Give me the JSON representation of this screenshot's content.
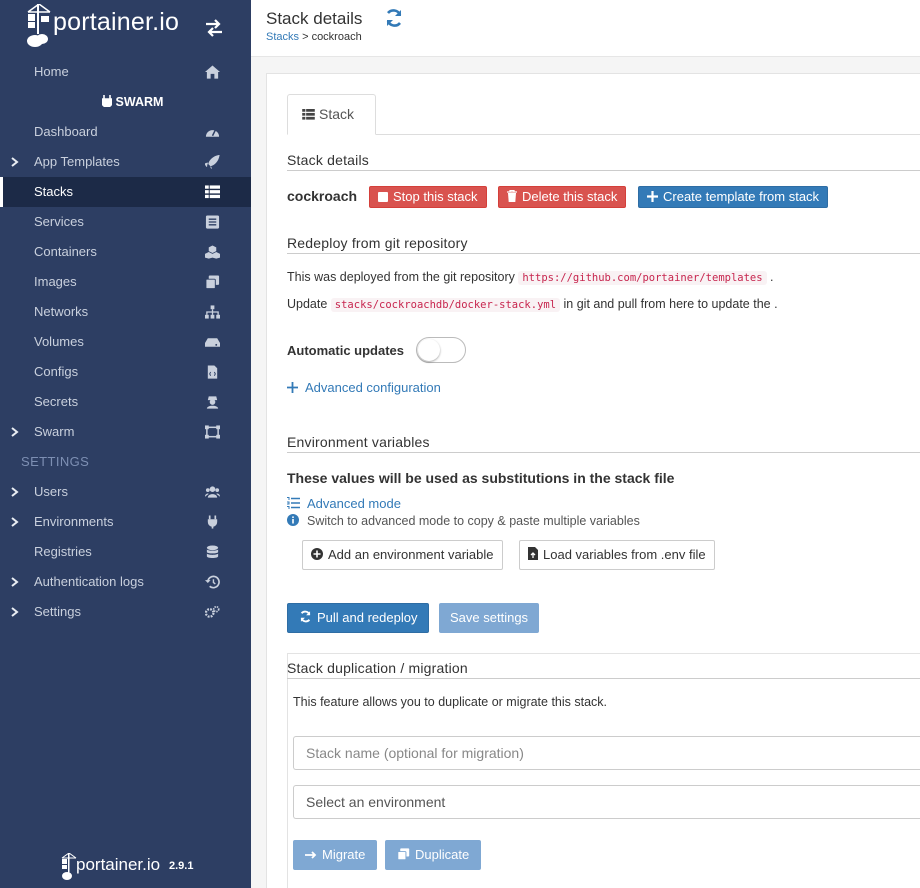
{
  "brand": {
    "name": "portainer.io"
  },
  "sidebar": {
    "home": "Home",
    "group": "SWARM",
    "items": [
      {
        "label": "Dashboard",
        "icon": "tachometer-icon"
      },
      {
        "label": "App Templates",
        "icon": "rocket-icon",
        "expandable": true
      },
      {
        "label": "Stacks",
        "icon": "th-list-icon",
        "active": true
      },
      {
        "label": "Services",
        "icon": "list-alt-icon"
      },
      {
        "label": "Containers",
        "icon": "cubes-icon"
      },
      {
        "label": "Images",
        "icon": "clone-icon"
      },
      {
        "label": "Networks",
        "icon": "sitemap-icon"
      },
      {
        "label": "Volumes",
        "icon": "hdd-icon"
      },
      {
        "label": "Configs",
        "icon": "file-code-icon"
      },
      {
        "label": "Secrets",
        "icon": "user-secret-icon"
      },
      {
        "label": "Swarm",
        "icon": "object-group-icon",
        "expandable": true
      }
    ],
    "settings_header": "SETTINGS",
    "settings_items": [
      {
        "label": "Users",
        "icon": "users-icon",
        "expandable": true
      },
      {
        "label": "Environments",
        "icon": "plug-icon",
        "expandable": true
      },
      {
        "label": "Registries",
        "icon": "database-icon"
      },
      {
        "label": "Authentication logs",
        "icon": "history-icon",
        "expandable": true
      },
      {
        "label": "Settings",
        "icon": "cogs-icon",
        "expandable": true
      }
    ],
    "footer": {
      "brand": "portainer.io",
      "version": "2.9.1"
    }
  },
  "header": {
    "title": "Stack details",
    "breadcrumb": {
      "parent": "Stacks",
      "separator": " > ",
      "current": "cockroach"
    }
  },
  "tabs": {
    "stack": "Stack"
  },
  "stack_details": {
    "title": "Stack details",
    "name": "cockroach",
    "stop_label": "Stop this stack",
    "delete_label": "Delete this stack",
    "template_label": "Create template from stack"
  },
  "redeploy": {
    "title": "Redeploy from git repository",
    "line1_prefix": "This was deployed from the git repository ",
    "repo_url": "https://github.com/portainer/templates",
    "line1_suffix": " .",
    "line2_prefix": "Update ",
    "compose_path": "stacks/cockroachdb/docker-stack.yml",
    "line2_suffix": " in git and pull from here to update the .",
    "auto_updates_label": "Automatic updates",
    "auto_updates_enabled": false,
    "advanced_config": "Advanced configuration"
  },
  "env": {
    "title": "Environment variables",
    "description": "These values will be used as substitutions in the stack file",
    "advanced_mode": "Advanced mode",
    "hint": "Switch to advanced mode to copy & paste multiple variables",
    "add_label": "Add an environment variable",
    "load_label": "Load variables from .env file"
  },
  "actions": {
    "pull_redeploy": "Pull and redeploy",
    "save_settings": "Save settings"
  },
  "duplication": {
    "title": "Stack duplication / migration",
    "description": "This feature allows you to duplicate or migrate this stack.",
    "name_placeholder": "Stack name (optional for migration)",
    "env_select": "Select an environment",
    "migrate_label": "Migrate",
    "duplicate_label": "Duplicate"
  },
  "colors": {
    "sidebar": "#2d3e63",
    "primary": "#337ab7",
    "danger": "#d9534f"
  }
}
